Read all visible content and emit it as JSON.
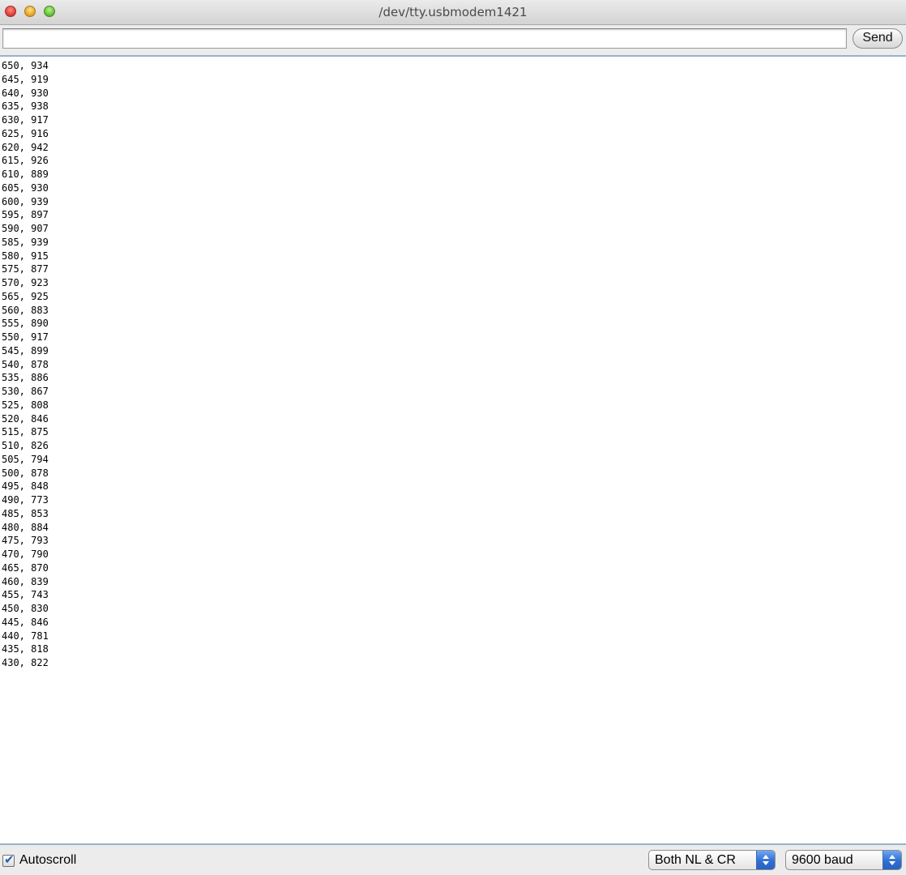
{
  "window": {
    "title": "/dev/tty.usbmodem1421"
  },
  "send_row": {
    "input_value": "",
    "send_label": "Send"
  },
  "output": {
    "lines": [
      "650, 934",
      "645, 919",
      "640, 930",
      "635, 938",
      "630, 917",
      "625, 916",
      "620, 942",
      "615, 926",
      "610, 889",
      "605, 930",
      "600, 939",
      "595, 897",
      "590, 907",
      "585, 939",
      "580, 915",
      "575, 877",
      "570, 923",
      "565, 925",
      "560, 883",
      "555, 890",
      "550, 917",
      "545, 899",
      "540, 878",
      "535, 886",
      "530, 867",
      "525, 808",
      "520, 846",
      "515, 875",
      "510, 826",
      "505, 794",
      "500, 878",
      "495, 848",
      "490, 773",
      "485, 853",
      "480, 884",
      "475, 793",
      "470, 790",
      "465, 870",
      "460, 839",
      "455, 743",
      "450, 830",
      "445, 846",
      "440, 781",
      "435, 818",
      "430, 822"
    ]
  },
  "footer": {
    "autoscroll_label": "Autoscroll",
    "autoscroll_checked": true,
    "line_ending_selected": "Both NL & CR",
    "baud_selected": "9600 baud"
  },
  "colors": {
    "stepper_blue": "#2f6fd6",
    "output_border": "#9bb1c9",
    "close_red": "#e0443e",
    "minimize_yellow": "#e9a92b",
    "zoom_green": "#6ac23c"
  }
}
